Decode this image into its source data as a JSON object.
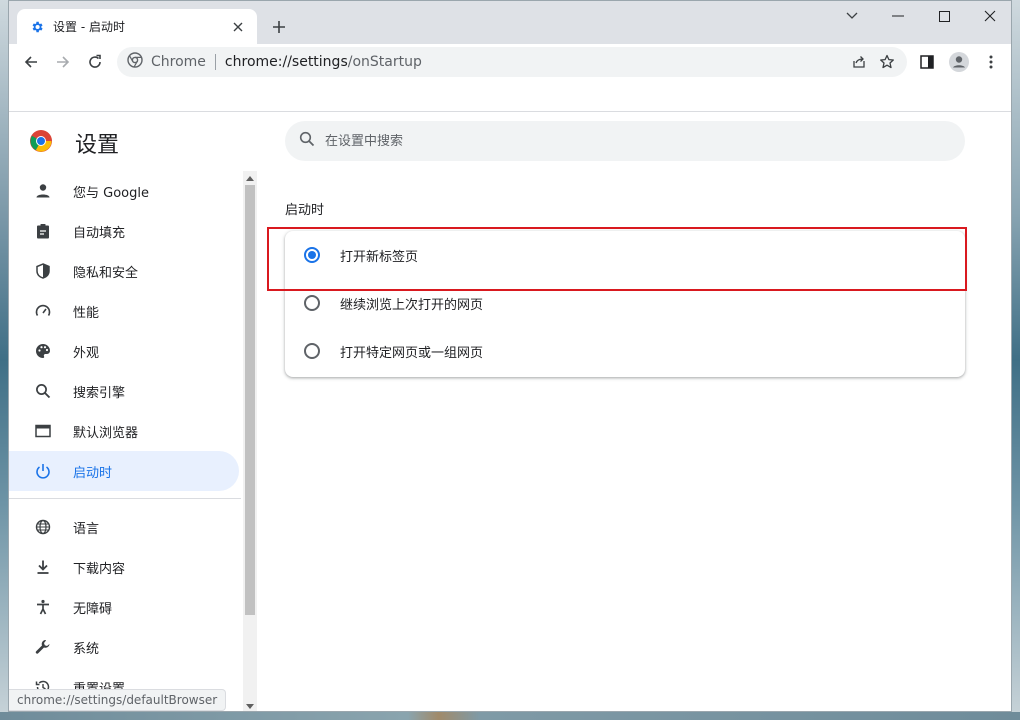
{
  "tab": {
    "title": "设置 - 启动时",
    "favicon": "gear-icon"
  },
  "window_controls": [
    "minimize",
    "maximize",
    "close"
  ],
  "omnibox": {
    "site_name": "Chrome",
    "url_host": "chrome://settings",
    "url_path": "/onStartup"
  },
  "settings": {
    "title": "设置",
    "search_placeholder": "在设置中搜索",
    "nav": [
      {
        "label": "您与 Google",
        "icon": "person-icon"
      },
      {
        "label": "自动填充",
        "icon": "clipboard-icon"
      },
      {
        "label": "隐私和安全",
        "icon": "shield-icon"
      },
      {
        "label": "性能",
        "icon": "speedometer-icon"
      },
      {
        "label": "外观",
        "icon": "palette-icon"
      },
      {
        "label": "搜索引擎",
        "icon": "search-icon"
      },
      {
        "label": "默认浏览器",
        "icon": "browser-window-icon"
      },
      {
        "label": "启动时",
        "icon": "power-icon",
        "active": true
      },
      {
        "label": "语言",
        "icon": "globe-icon"
      },
      {
        "label": "下载内容",
        "icon": "download-icon"
      },
      {
        "label": "无障碍",
        "icon": "accessibility-icon"
      },
      {
        "label": "系统",
        "icon": "wrench-icon"
      },
      {
        "label": "重置设置",
        "icon": "history-icon"
      }
    ],
    "section_title": "启动时",
    "options": [
      {
        "label": "打开新标签页",
        "checked": true
      },
      {
        "label": "继续浏览上次打开的网页",
        "checked": false
      },
      {
        "label": "打开特定网页或一组网页",
        "checked": false
      }
    ]
  },
  "status_bar_url": "chrome://settings/defaultBrowser",
  "colors": {
    "accent": "#1a73e8",
    "highlight": "#d9191f",
    "active_nav_bg": "#e8f0fe"
  }
}
